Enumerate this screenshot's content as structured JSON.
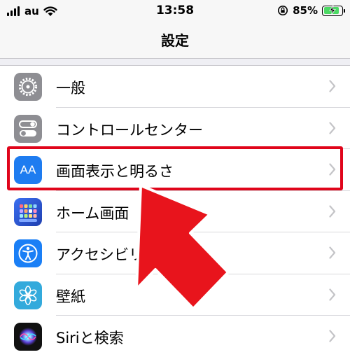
{
  "status_bar": {
    "carrier": "au",
    "time": "13:58",
    "battery": "85%",
    "battery_level": 0.85
  },
  "nav": {
    "title": "設定"
  },
  "settings": [
    {
      "label": "一般",
      "icon": "gear-icon",
      "color": "#8e8e93"
    },
    {
      "label": "コントロールセンター",
      "icon": "toggles-icon",
      "color": "#8e8e93"
    },
    {
      "label": "画面表示と明るさ",
      "icon": "text-size-icon",
      "color": "#1e7cf0",
      "icon_text": "AA"
    },
    {
      "label": "ホーム画面",
      "icon": "home-grid-icon",
      "color": "#2c5bd6"
    },
    {
      "label": "アクセシビリティ",
      "icon": "accessibility-icon",
      "color": "#1a7ff6"
    },
    {
      "label": "壁紙",
      "icon": "flower-icon",
      "color": "#33aadc"
    },
    {
      "label": "Siriと検索",
      "icon": "siri-icon",
      "color": "#111111"
    }
  ],
  "colors": {
    "highlight": "#e0051b",
    "chevron": "#c4c4c7"
  }
}
